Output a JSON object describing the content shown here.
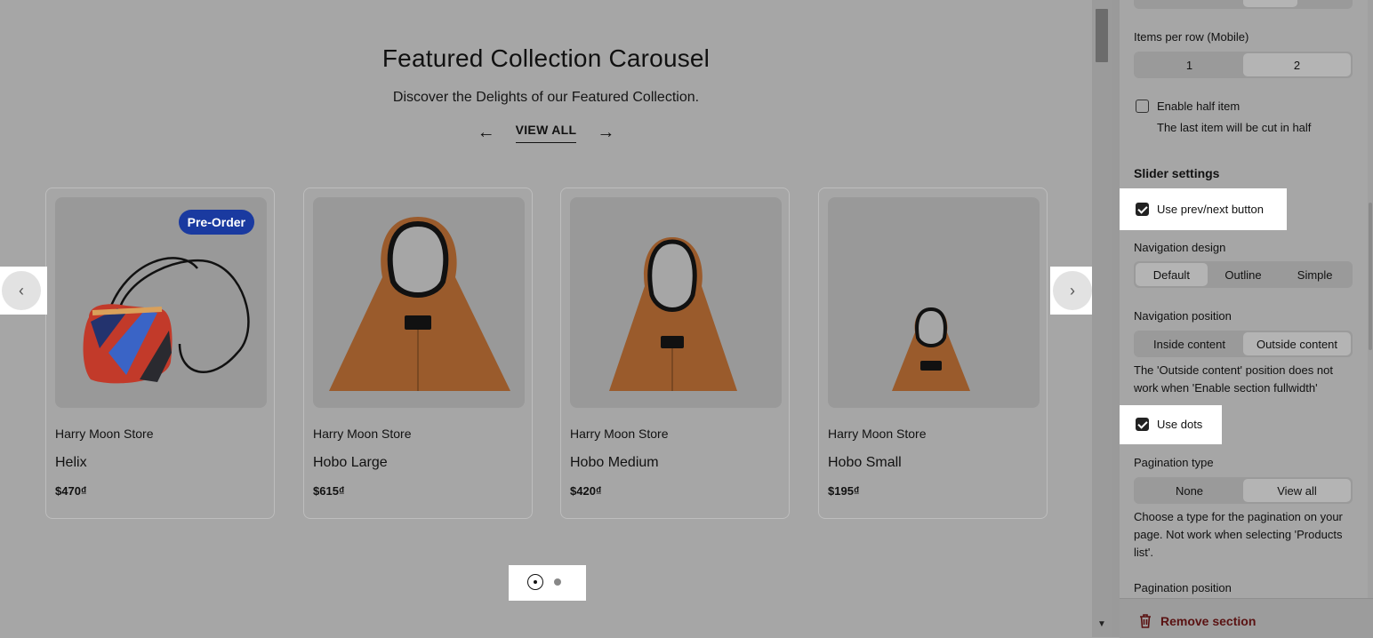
{
  "preview": {
    "title": "Featured Collection Carousel",
    "subtitle": "Discover the Delights of our Featured Collection.",
    "view_all": "VIEW ALL",
    "prev_icon": "arrow-left-icon",
    "next_icon": "arrow-right-icon",
    "products": [
      {
        "store": "Harry Moon Store",
        "name": "Helix",
        "price": "$470₫",
        "badge": "Pre-Order"
      },
      {
        "store": "Harry Moon Store",
        "name": "Hobo Large",
        "price": "$615₫"
      },
      {
        "store": "Harry Moon Store",
        "name": "Hobo Medium",
        "price": "$420₫"
      },
      {
        "store": "Harry Moon Store",
        "name": "Hobo Small",
        "price": "$195₫"
      }
    ],
    "slider_prev_icon": "chevron-left-icon",
    "slider_next_icon": "chevron-right-icon",
    "dots_count": 2,
    "active_dot": 1
  },
  "panel": {
    "items_per_row_mobile": {
      "label": "Items per row (Mobile)",
      "options": [
        "1",
        "2"
      ],
      "selected": "2"
    },
    "half_item": {
      "label": "Enable half item",
      "help": "The last item will be cut in half",
      "checked": false
    },
    "slider_heading": "Slider settings",
    "prev_next": {
      "label": "Use prev/next button",
      "checked": true
    },
    "nav_design": {
      "label": "Navigation design",
      "options": [
        "Default",
        "Outline",
        "Simple"
      ],
      "selected": "Default"
    },
    "nav_position": {
      "label": "Navigation position",
      "options": [
        "Inside content",
        "Outside content"
      ],
      "selected": "Outside content",
      "help": "The 'Outside content' position does not work when 'Enable section fullwidth'"
    },
    "dots": {
      "label": "Use dots",
      "checked": true
    },
    "pagination_type": {
      "label": "Pagination type",
      "options": [
        "None",
        "View all"
      ],
      "selected": "View all",
      "help": "Choose a type for the pagination on your page. Not work when selecting 'Products list'."
    },
    "pagination_position": {
      "label": "Pagination position"
    },
    "remove_section": "Remove section"
  },
  "colors": {
    "badge": "#1a3aa0",
    "remove": "#5a1212",
    "overlay": "#a6a6a6"
  }
}
